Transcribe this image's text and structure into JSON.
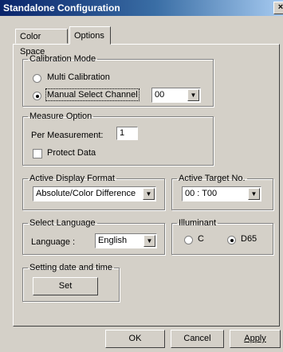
{
  "window": {
    "title": "Standalone Configuration",
    "close_label": "×"
  },
  "tabs": [
    {
      "label": "Color Space"
    },
    {
      "label": "Options"
    }
  ],
  "calibration_mode": {
    "legend": "Calibration Mode",
    "multi_label": "Multi Calibration",
    "manual_label": "Manual Select Channel",
    "channel_value": "00",
    "selected": "manual"
  },
  "measure_option": {
    "legend": "Measure Option",
    "per_measurement_label": "Per Measurement:",
    "per_measurement_value": "1",
    "protect_data_label": "Protect Data",
    "protect_data_checked": false
  },
  "active_display_format": {
    "legend": "Active Display Format",
    "value": "Absolute/Color Difference"
  },
  "active_target": {
    "legend": "Active Target No.",
    "value": "00 : T00"
  },
  "select_language": {
    "legend": "Select Language",
    "language_label": "Language :",
    "value": "English"
  },
  "illuminant": {
    "legend": "Illuminant",
    "c_label": "C",
    "d65_label": "D65",
    "selected": "D65"
  },
  "date_time": {
    "legend": "Setting date and time",
    "set_label": "Set"
  },
  "buttons": {
    "ok": "OK",
    "cancel": "Cancel",
    "apply": "Apply"
  }
}
